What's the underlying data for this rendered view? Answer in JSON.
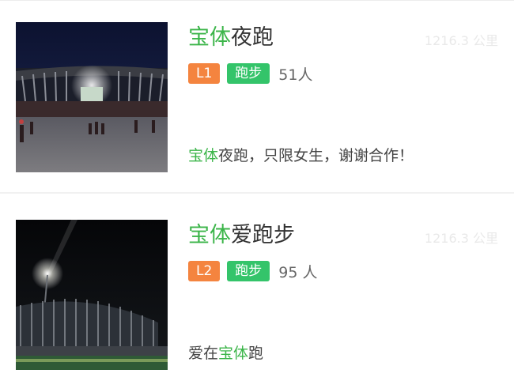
{
  "groups": [
    {
      "name_highlight": "宝体",
      "name_rest": "夜跑",
      "distance": "1216.3 公里",
      "level": "L1",
      "sport": "跑步",
      "members": "51人",
      "desc_highlight": "宝体",
      "desc_rest": "夜跑，只限女生，谢谢合作！",
      "image_alt": "stadium-at-night-plaza"
    },
    {
      "name_highlight": "宝体",
      "name_rest": "爱跑步",
      "distance": "1216.3 公里",
      "level": "L2",
      "sport": "跑步",
      "members": "95 人",
      "desc_prefix": "爱在",
      "desc_highlight": "宝体",
      "desc_rest": "跑",
      "image_alt": "stadium-floodlight-night"
    }
  ],
  "colors": {
    "highlight": "#3cb54a",
    "level_badge": "#f4843f",
    "sport_badge": "#34c46a"
  }
}
